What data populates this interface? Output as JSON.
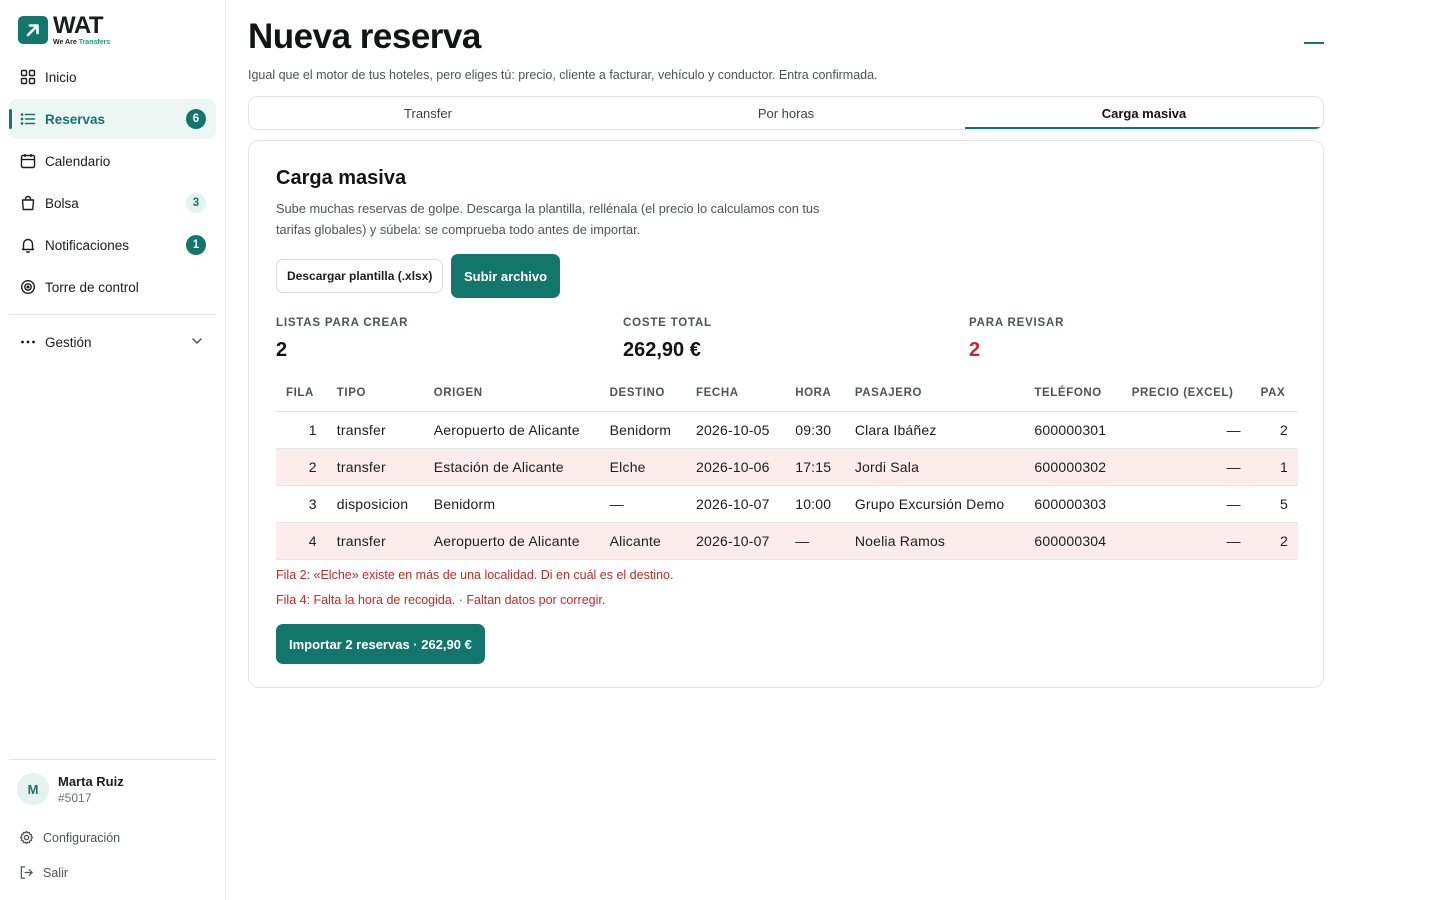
{
  "brand": {
    "name": "WAT",
    "tagline_a": "We Are",
    "tagline_b": "Transfers"
  },
  "colors": {
    "accent": "#13766d",
    "error": "#c62828",
    "error_row_bg": "#fdecec"
  },
  "sidebar": {
    "items": [
      {
        "label": "Inicio",
        "icon": "grid-icon"
      },
      {
        "label": "Reservas",
        "icon": "list-icon",
        "badge": "6",
        "active": true
      },
      {
        "label": "Calendario",
        "icon": "calendar-icon"
      },
      {
        "label": "Bolsa",
        "icon": "bag-icon",
        "badge": "3"
      },
      {
        "label": "Notificaciones",
        "icon": "bell-icon",
        "badge": "1"
      },
      {
        "label": "Torre de control",
        "icon": "target-icon"
      },
      {
        "label": "Gestión",
        "icon": "more-dots-icon"
      }
    ],
    "user": {
      "initial": "M",
      "name": "Marta Ruiz",
      "id": "#5017"
    },
    "settings_label": "Configuración",
    "logout_label": "Salir"
  },
  "header": {
    "title": "Nueva reserva",
    "subtitle": "Igual que el motor de tus hoteles, pero eliges tú: precio, cliente a facturar, vehículo y conductor. Entra confirmada."
  },
  "tabs": [
    {
      "label": "Transfer"
    },
    {
      "label": "Por horas"
    },
    {
      "label": "Carga masiva",
      "active": true
    }
  ],
  "card": {
    "title": "Carga masiva",
    "description": "Sube muchas reservas de golpe. Descarga la plantilla, rellénala (el precio lo calculamos con tus tarifas globales) y súbela: se comprueba todo antes de importar.",
    "download_label": "Descargar plantilla (.xlsx)",
    "upload_label": "Subir archivo",
    "stats": [
      {
        "label": "LISTAS PARA CREAR",
        "value": "2"
      },
      {
        "label": "COSTE TOTAL",
        "value": "262,90 €"
      },
      {
        "label": "PARA REVISAR",
        "value": "2"
      }
    ],
    "table": {
      "headers": [
        "FILA",
        "TIPO",
        "ORIGEN",
        "DESTINO",
        "FECHA",
        "HORA",
        "PASAJERO",
        "TELÉFONO",
        "PRECIO (EXCEL)",
        "PAX"
      ],
      "rows": [
        {
          "fila": "1",
          "tipo": "transfer",
          "origen": "Aeropuerto de Alicante",
          "destino": "Benidorm",
          "fecha": "2026-10-05",
          "hora": "09:30",
          "pasajero": "Clara Ibáñez",
          "telefono": "600000301",
          "precio": "—",
          "pax": "2",
          "error": false
        },
        {
          "fila": "2",
          "tipo": "transfer",
          "origen": "Estación de Alicante",
          "destino": "Elche",
          "fecha": "2026-10-06",
          "hora": "17:15",
          "pasajero": "Jordi Sala",
          "telefono": "600000302",
          "precio": "—",
          "pax": "1",
          "error": true
        },
        {
          "fila": "3",
          "tipo": "disposicion",
          "origen": "Benidorm",
          "destino": "—",
          "fecha": "2026-10-07",
          "hora": "10:00",
          "pasajero": "Grupo Excursión Demo",
          "telefono": "600000303",
          "precio": "—",
          "pax": "5",
          "error": false
        },
        {
          "fila": "4",
          "tipo": "transfer",
          "origen": "Aeropuerto de Alicante",
          "destino": "Alicante",
          "fecha": "2026-10-07",
          "hora": "—",
          "pasajero": "Noelia Ramos",
          "telefono": "600000304",
          "precio": "—",
          "pax": "2",
          "error": true
        }
      ]
    },
    "errors": [
      "Fila 2: «Elche» existe en más de una localidad. Di en cuál es el destino.",
      "Fila 4: Falta la hora de recogida. · Faltan datos por corregir."
    ],
    "import_label": "Importar 2 reservas · 262,90 €"
  }
}
